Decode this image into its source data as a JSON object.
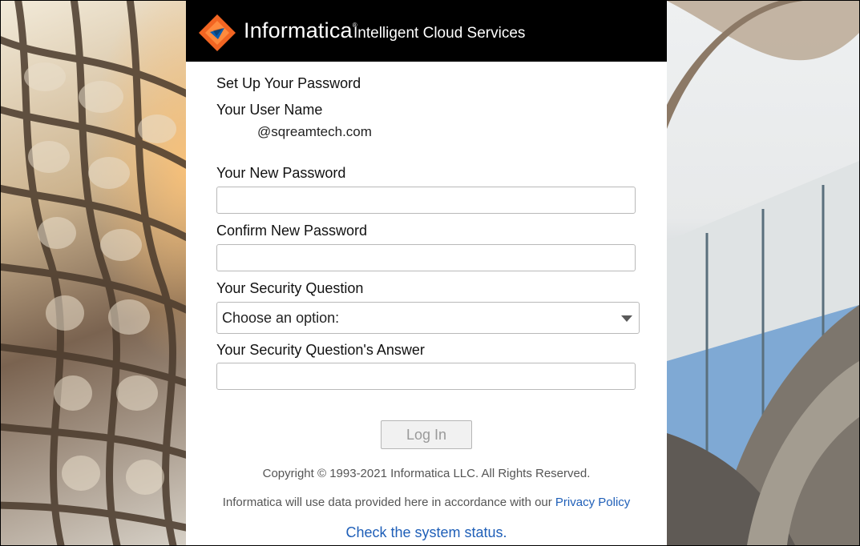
{
  "brand": {
    "name": "Informatica",
    "tm": "®",
    "product": "Intelligent Cloud Services"
  },
  "form": {
    "title": "Set Up Your Password",
    "username_label": "Your User Name",
    "username_value": "@sqreamtech.com",
    "new_password_label": "Your New Password",
    "new_password_value": "",
    "confirm_password_label": "Confirm New Password",
    "confirm_password_value": "",
    "security_question_label": "Your Security Question",
    "security_question_selected": "Choose an option:",
    "security_answer_label": "Your Security Question's Answer",
    "security_answer_value": "",
    "login_label": "Log In"
  },
  "footer": {
    "copyright": "Copyright © 1993-2021 Informatica LLC. All Rights Reserved.",
    "privacy_text": "Informatica will use data provided here in accordance with our ",
    "privacy_link": "Privacy Policy",
    "status_link": "Check the system status."
  },
  "colors": {
    "header_bg": "#000000",
    "link": "#1f5fb8",
    "logo_orange": "#f26522",
    "logo_blue": "#0b5cad"
  },
  "icons": {
    "logo": "informatica-diamond-logo-icon",
    "dropdown": "chevron-down-icon"
  }
}
